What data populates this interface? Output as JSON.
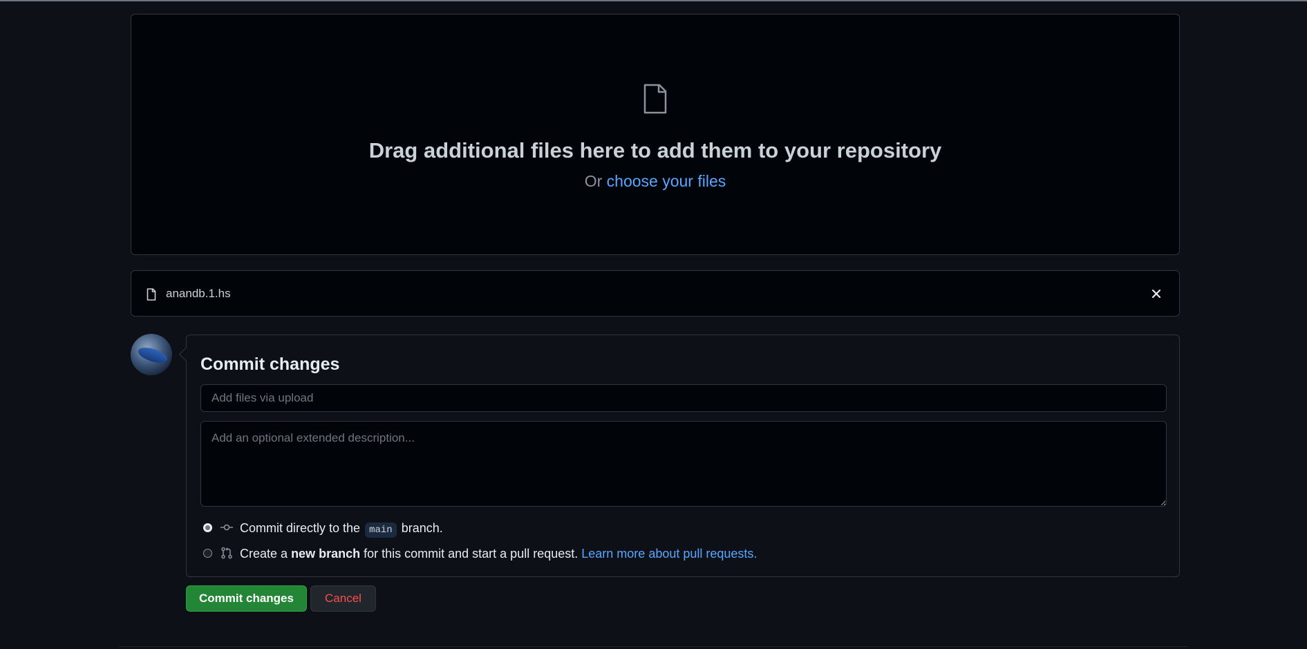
{
  "dropzone": {
    "icon": "file-icon",
    "title": "Drag additional files here to add them to your repository",
    "or_text": "Or",
    "choose_link": "choose your files"
  },
  "file": {
    "icon": "file-icon",
    "name": "anandb.1.hs",
    "remove_icon": "close-icon"
  },
  "commit": {
    "title": "Commit changes",
    "summary_placeholder": "Add files via upload",
    "summary_value": "",
    "description_placeholder": "Add an optional extended description...",
    "description_value": "",
    "option_direct": {
      "selected": true,
      "icon": "git-commit-icon",
      "prefix": "Commit directly to the",
      "branch": "main",
      "suffix": "branch."
    },
    "option_new_branch": {
      "selected": false,
      "icon": "git-pull-request-icon",
      "prefix": "Create a",
      "bold": "new branch",
      "suffix": "for this commit and start a pull request.",
      "link": "Learn more about pull requests."
    }
  },
  "actions": {
    "commit_label": "Commit changes",
    "cancel_label": "Cancel"
  },
  "colors": {
    "background": "#0d1117",
    "accent_link": "#58a6ff",
    "primary_button": "#238636",
    "danger_text": "#f85149"
  }
}
